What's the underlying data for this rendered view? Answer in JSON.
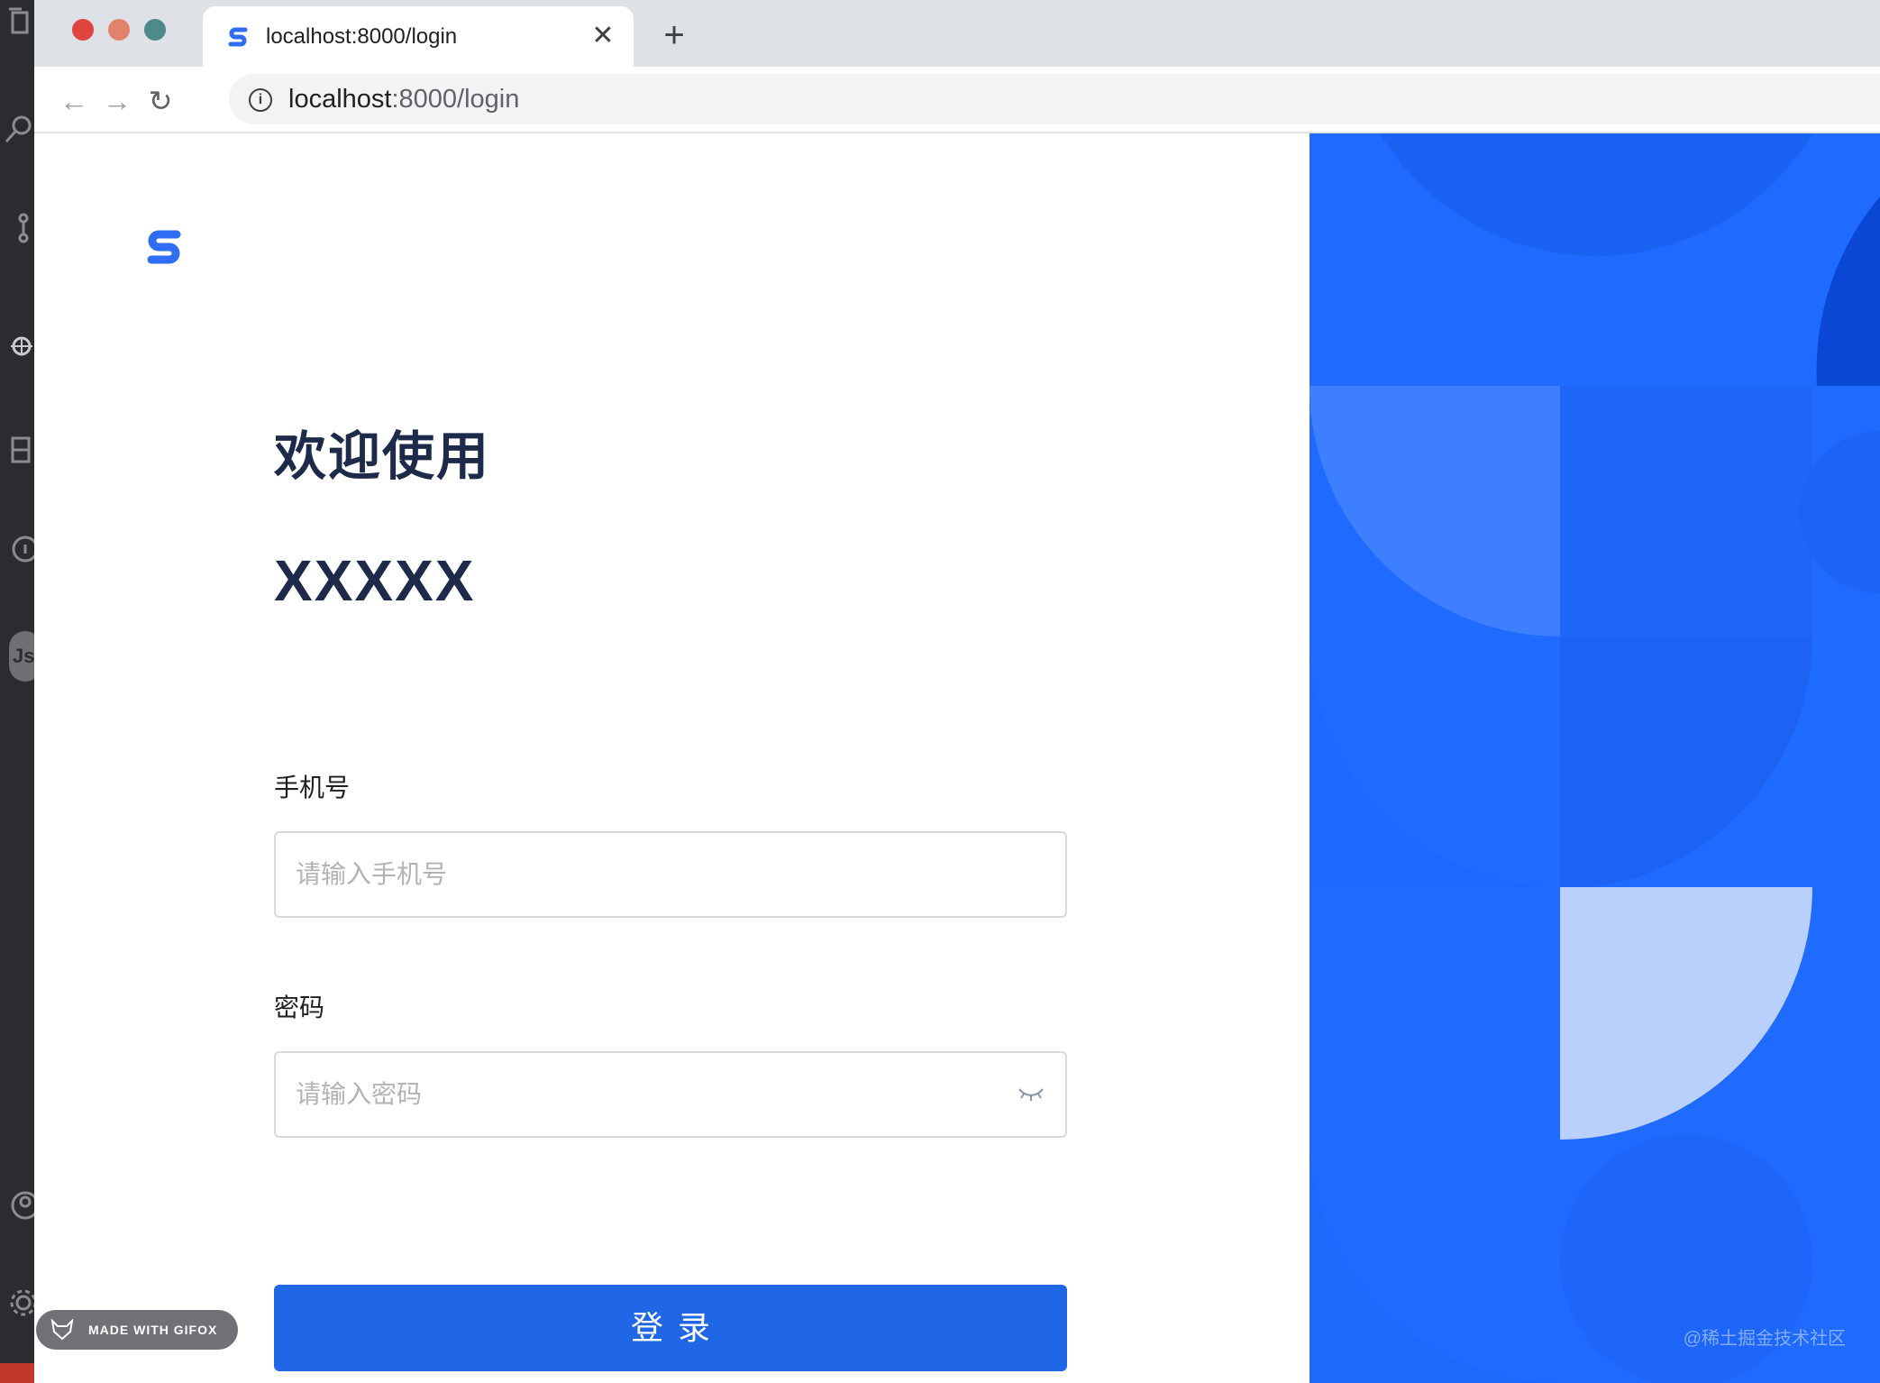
{
  "browser": {
    "tab_title": "localhost:8000/login",
    "close_tab_icon": "close-icon",
    "new_tab_icon": "plus-icon",
    "url_host": "localhost",
    "url_rest": ":8000/login",
    "back_icon": "arrow-left-icon",
    "forward_icon": "arrow-right-icon",
    "reload_icon": "reload-icon",
    "site_info_icon": "info-icon"
  },
  "login": {
    "welcome": "欢迎使用",
    "brand": "XXXXX",
    "phone_label": "手机号",
    "phone_placeholder": "请输入手机号",
    "password_label": "密码",
    "password_placeholder": "请输入密码",
    "password_toggle_icon": "eye-closed-icon",
    "submit_label": "登录"
  },
  "overlay": {
    "gifox_badge": "MADE WITH GIFOX",
    "watermark": "@稀土掘金技术社区"
  },
  "colors": {
    "accent": "#1f67e6",
    "panel_blue": "#1f6bff",
    "heading": "#1e2a4a"
  }
}
